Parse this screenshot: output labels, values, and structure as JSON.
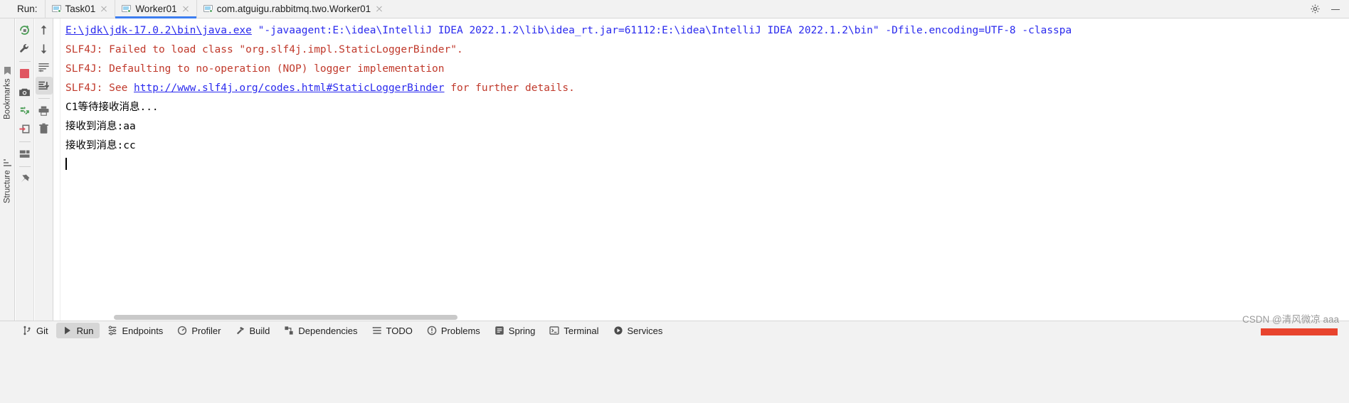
{
  "window": {
    "run_label": "Run:",
    "gear_icon": "gear-icon",
    "minimize_icon": "minimize-icon"
  },
  "tabs": [
    {
      "label": "Task01",
      "icon": "run-configuration-icon",
      "close_icon": "close-icon",
      "active": false
    },
    {
      "label": "Worker01",
      "icon": "run-configuration-icon",
      "close_icon": "close-icon",
      "active": true
    },
    {
      "label": "com.atguigu.rabbitmq.two.Worker01",
      "icon": "run-configuration-icon",
      "close_icon": "close-icon",
      "active": false
    }
  ],
  "run_toolbar_primary": [
    {
      "name": "rerun-icon",
      "title": "Rerun"
    },
    {
      "name": "edit-configuration-wrench-icon",
      "title": "Modify Run Configuration"
    },
    {
      "name": "stop-square-icon",
      "title": "Stop"
    },
    {
      "name": "camera-snapshot-icon",
      "title": "Capture Memory Snapshot"
    },
    {
      "name": "thread-dump-icon",
      "title": "Get Thread Dump"
    },
    {
      "name": "export-icon",
      "title": "Export to Text File"
    },
    {
      "name": "layout-icon",
      "title": "Layout Settings"
    },
    {
      "name": "pin-icon",
      "title": "Pin Tab"
    }
  ],
  "run_toolbar_secondary": [
    {
      "name": "arrow-up-icon",
      "title": "Up the Stack Trace"
    },
    {
      "name": "arrow-down-icon",
      "title": "Down the Stack Trace"
    },
    {
      "name": "soft-wrap-icon",
      "title": "Soft-Wrap"
    },
    {
      "name": "scroll-to-end-icon",
      "title": "Scroll to the End",
      "selected": true
    },
    {
      "name": "print-icon",
      "title": "Print"
    },
    {
      "name": "trash-icon",
      "title": "Clear All"
    }
  ],
  "left_strip": [
    {
      "label": "Bookmarks",
      "icon": "bookmark-icon"
    },
    {
      "label": "Structure",
      "icon": "structure-icon"
    }
  ],
  "console": {
    "lines": [
      {
        "id": "cmdline",
        "segments": [
          {
            "text": "E:\\jdk\\jdk-17.0.2\\bin\\java.exe",
            "style": "link"
          },
          {
            "text": " \"-javaagent:E:\\idea\\IntelliJ IDEA 2022.1.2\\lib\\idea_rt.jar=61112:E:\\idea\\IntelliJ IDEA 2022.1.2\\bin\" -Dfile.encoding=UTF-8 -classpa",
            "style": "blue"
          }
        ]
      },
      {
        "id": "slf4j-failed",
        "segments": [
          {
            "text": "SLF4J: Failed to load class \"org.slf4j.impl.StaticLoggerBinder\".",
            "style": "red"
          }
        ]
      },
      {
        "id": "slf4j-defaulting",
        "segments": [
          {
            "text": "SLF4J: Defaulting to no-operation (NOP) logger implementation",
            "style": "red"
          }
        ]
      },
      {
        "id": "slf4j-see",
        "segments": [
          {
            "text": "SLF4J: See ",
            "style": "red"
          },
          {
            "text": "http://www.slf4j.org/codes.html#StaticLoggerBinder",
            "style": "link"
          },
          {
            "text": " for further details.",
            "style": "red"
          }
        ]
      },
      {
        "id": "waiting",
        "segments": [
          {
            "text": "C1等待接收消息...",
            "style": "plain"
          }
        ]
      },
      {
        "id": "received-aa",
        "segments": [
          {
            "text": "接收到消息:aa",
            "style": "plain"
          }
        ]
      },
      {
        "id": "received-cc",
        "segments": [
          {
            "text": "接收到消息:cc",
            "style": "plain"
          }
        ]
      }
    ],
    "caret_visible": true
  },
  "status_bar": [
    {
      "label": "Git",
      "icon": "git-branch-icon",
      "active": false
    },
    {
      "label": "Run",
      "icon": "run-play-icon",
      "active": true
    },
    {
      "label": "Endpoints",
      "icon": "endpoints-icon",
      "active": false
    },
    {
      "label": "Profiler",
      "icon": "profiler-icon",
      "active": false
    },
    {
      "label": "Build",
      "icon": "build-hammer-icon",
      "active": false
    },
    {
      "label": "Dependencies",
      "icon": "dependencies-icon",
      "active": false
    },
    {
      "label": "TODO",
      "icon": "todo-list-icon",
      "active": false
    },
    {
      "label": "Problems",
      "icon": "problems-warning-icon",
      "active": false
    },
    {
      "label": "Spring",
      "icon": "spring-leaf-icon",
      "active": false
    },
    {
      "label": "Terminal",
      "icon": "terminal-icon",
      "active": false
    },
    {
      "label": "Services",
      "icon": "services-icon",
      "active": false
    }
  ],
  "watermark": {
    "text": "CSDN @清风微凉 aaa"
  },
  "colors": {
    "accent_tab": "#3d7ef0",
    "link": "#2a2aee",
    "error": "#c0392b",
    "chrome": "#f2f2f2",
    "console_bg": "#ffffff",
    "green_run": "#59a869",
    "red_accent": "#e8442e"
  }
}
